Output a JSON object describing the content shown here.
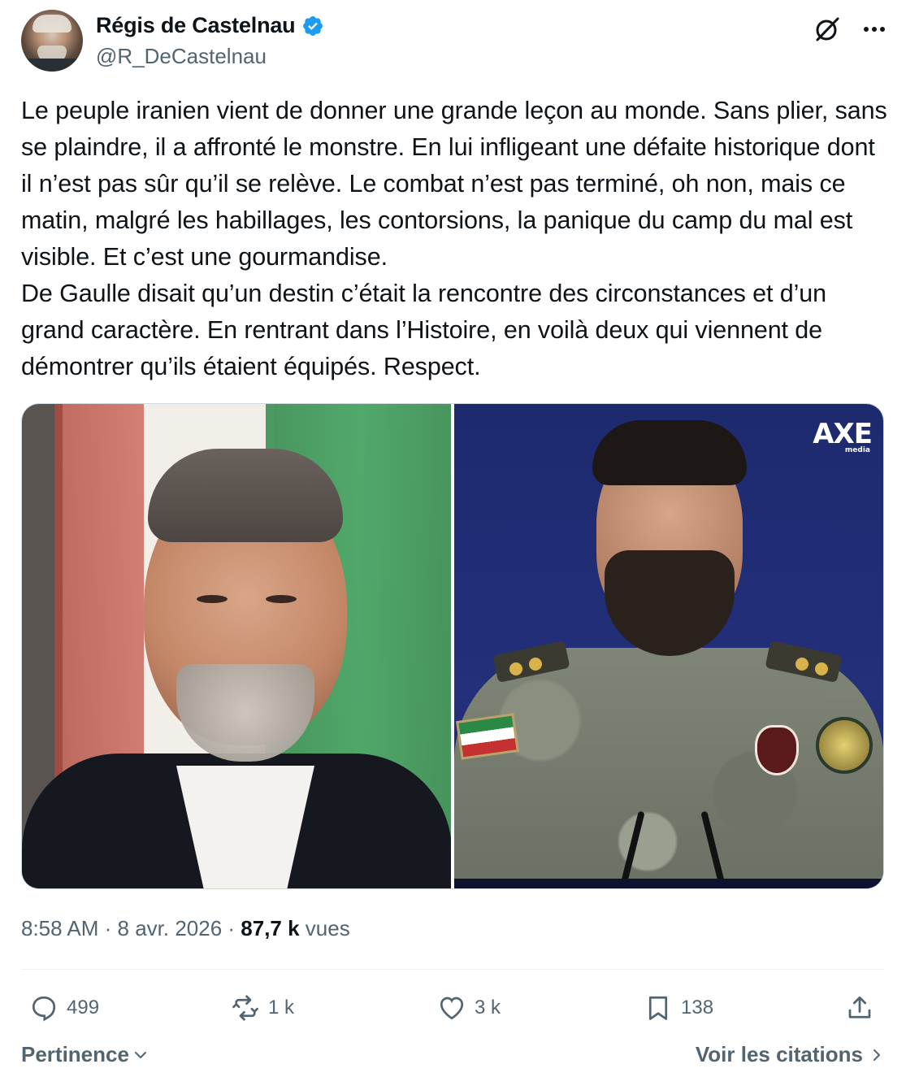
{
  "author": {
    "name": "Régis de Castelnau",
    "handle": "@R_DeCastelnau"
  },
  "tweet": {
    "text": "Le peuple iranien vient de donner une grande leçon au monde. Sans plier, sans se plaindre, il a affronté le monstre. En lui infligeant une défaite historique dont il n’est pas sûr qu’il se relève. Le combat n’est pas terminé, oh non, mais ce matin, malgré les habillages, les contorsions, la panique du camp du mal est visible. Et c’est une gourmandise.\nDe Gaulle disait qu’un destin c’était la rencontre des circonstances et d’un grand caractère. En rentrant dans l’Histoire, en voilà deux qui viennent de démontrer qu’ils étaient équipés. Respect."
  },
  "media": {
    "right_watermark": "AXE",
    "right_watermark_sub": "media"
  },
  "meta": {
    "time": "8:58 AM",
    "separator": " · ",
    "date": "8 avr. 2026",
    "views_count": "87,7 k",
    "views_label": " vues"
  },
  "actions": {
    "replies": "499",
    "reposts": "1 k",
    "likes": "3 k",
    "bookmarks": "138"
  },
  "footer": {
    "sort_label": "Pertinence",
    "quotes_label": "Voir les citations"
  },
  "colors": {
    "text": "#0f1419",
    "secondary": "#536471",
    "verified": "#1d9bf0",
    "border": "#cfd9de"
  }
}
